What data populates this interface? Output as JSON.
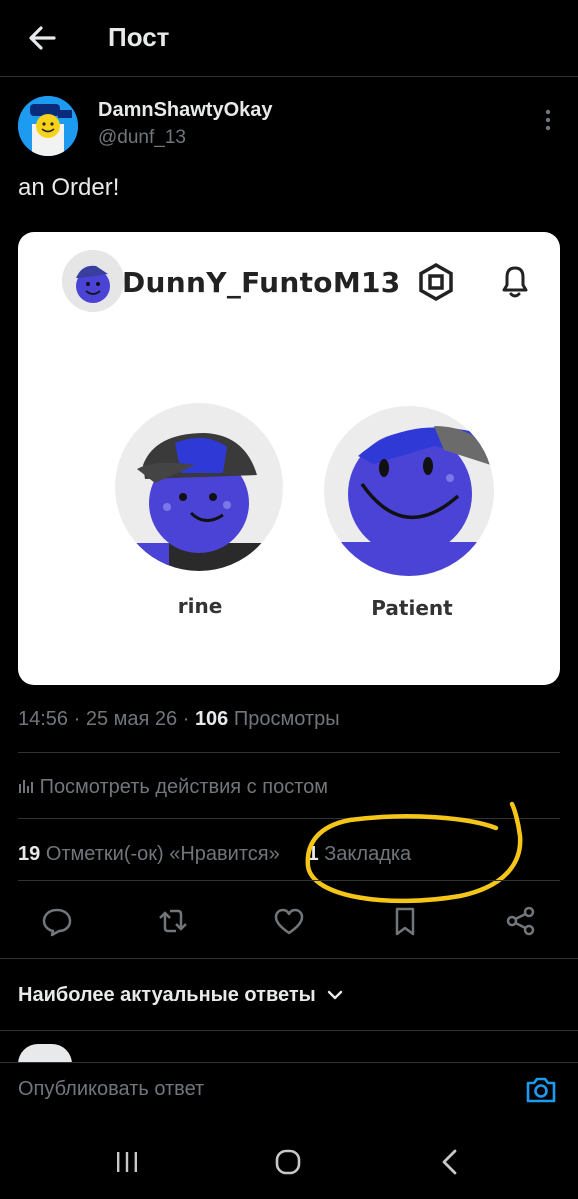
{
  "header": {
    "title": "Пост"
  },
  "post": {
    "author_name": "DamnShawtyOkay",
    "author_handle": "@dunf_13",
    "text": "an Order!",
    "card": {
      "username": "DunnY_FuntoM13",
      "profiles": [
        {
          "caption": "rine"
        },
        {
          "caption": "Patient"
        }
      ]
    },
    "time": "14:56",
    "date": "25 мая 26",
    "views_count": "106",
    "views_label": "Просмотры",
    "activity_link": "Посмотреть действия с постом",
    "likes_count": "19",
    "likes_label": "Отметки(-ок) «Нравится»",
    "bookmarks_count": "1",
    "bookmarks_label": "Закладка"
  },
  "replies": {
    "sort_label": "Наиболее актуальные ответы"
  },
  "reply_bar": {
    "placeholder": "Опубликовать ответ"
  },
  "colors": {
    "accent": "#1d9bf0",
    "highlight": "#f5c518",
    "avatar_blue": "#4a43d6"
  }
}
